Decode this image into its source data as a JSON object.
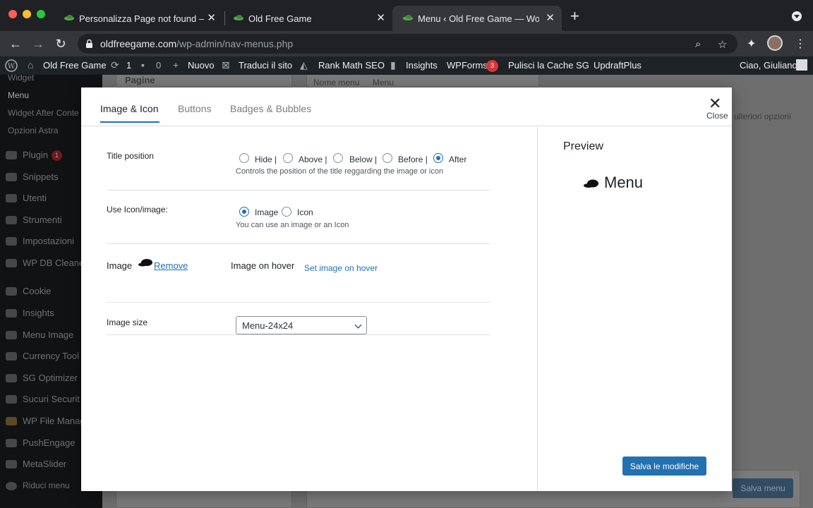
{
  "browser": {
    "tabs": [
      {
        "title": "Personalizza Page not found –"
      },
      {
        "title": "Old Free Game"
      },
      {
        "title": "Menu ‹ Old Free Game — Word"
      }
    ],
    "url_domain": "oldfreegame.com",
    "url_path": "/wp-admin/nav-menus.php"
  },
  "adminbar": {
    "site_name": "Old Free Game",
    "updates_count": "1",
    "comments_count": "0",
    "new_label": "Nuovo",
    "translate_label": "Traduci il sito",
    "rankmath_label": "Rank Math SEO",
    "insights_label": "Insights",
    "wpforms_label": "WPForms",
    "wpforms_count": "3",
    "cache_label": "Pulisci la Cache SG",
    "updraft_label": "UpdraftPlus",
    "greeting": "Ciao, Giuliano"
  },
  "sidebar": {
    "sub_items": [
      "Widget",
      "Menu",
      "Widget After Conte",
      "Opzioni Astra"
    ],
    "items": [
      "Plugin",
      "Snippets",
      "Utenti",
      "Strumenti",
      "Impostazioni",
      "WP DB Cleane",
      "Cookie",
      "Insights",
      "Menu Image",
      "Currency Tool",
      "SG Optimizer",
      "Sucuri Securit",
      "WP File Manag",
      "PushEngage",
      "MetaSlider",
      "Riduci menu"
    ],
    "plugin_badge": "1"
  },
  "background": {
    "pages_label": "Pagine",
    "menu_name_label": "Nome menu",
    "menu_name_value": "Menu",
    "more_options": "ulteriori opzioni",
    "save_menu": "Salva menu"
  },
  "modal": {
    "tabs": [
      "Image & Icon",
      "Buttons",
      "Badges & Bubbles"
    ],
    "close_label": "Close",
    "title_position": {
      "label": "Title position",
      "options": [
        "Hide |",
        "Above |",
        "Below |",
        "Before |",
        "After"
      ],
      "selected": "After",
      "description": "Controls the position of the title reggarding the image or icon"
    },
    "use_icon": {
      "label": "Use Icon/image:",
      "options": [
        "Image",
        "Icon"
      ],
      "selected": "Image",
      "description": "You can use an image or an Icon"
    },
    "image": {
      "label": "Image",
      "remove_link": "Remove",
      "hover_label": "Image on hover",
      "hover_link": "Set image on hover"
    },
    "image_size": {
      "label": "Image size",
      "value": "Menu-24x24"
    },
    "preview": {
      "title": "Preview",
      "menu_text": "Menu"
    },
    "save_button": "Salva le modifiche"
  }
}
